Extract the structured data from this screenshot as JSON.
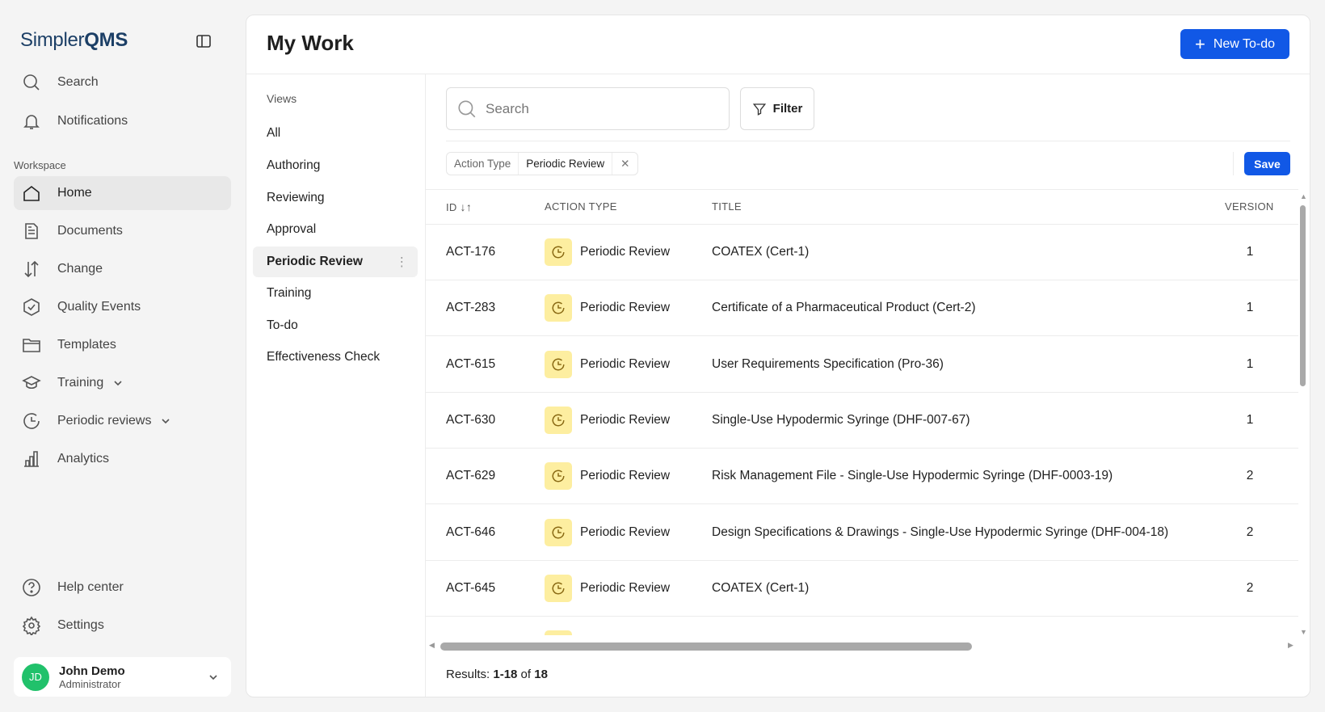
{
  "brand": {
    "name_part1": "Simpler",
    "name_part2": "QMS"
  },
  "sidebar": {
    "search": "Search",
    "notifications": "Notifications",
    "section": "Workspace",
    "items": [
      {
        "label": "Home"
      },
      {
        "label": "Documents"
      },
      {
        "label": "Change"
      },
      {
        "label": "Quality Events"
      },
      {
        "label": "Templates"
      },
      {
        "label": "Training"
      },
      {
        "label": "Periodic reviews"
      },
      {
        "label": "Analytics"
      }
    ],
    "help": "Help center",
    "settings": "Settings",
    "user": {
      "initials": "JD",
      "name": "John Demo",
      "role": "Administrator"
    }
  },
  "header": {
    "title": "My Work",
    "new_button": "New To-do"
  },
  "views": {
    "label": "Views",
    "items": [
      "All",
      "Authoring",
      "Reviewing",
      "Approval",
      "Periodic Review",
      "Training",
      "To-do",
      "Effectiveness Check"
    ],
    "active": "Periodic Review"
  },
  "toolbar": {
    "search_placeholder": "Search",
    "filter_label": "Filter",
    "save_label": "Save"
  },
  "active_filter": {
    "key": "Action Type",
    "value": "Periodic Review"
  },
  "table": {
    "columns": [
      "ID",
      "ACTION TYPE",
      "TITLE",
      "VERSION"
    ],
    "rows": [
      {
        "id": "ACT-176",
        "type": "Periodic Review",
        "title": "COATEX (Cert-1)",
        "version": "1"
      },
      {
        "id": "ACT-283",
        "type": "Periodic Review",
        "title": "Certificate of a Pharmaceutical Product (Cert-2)",
        "version": "1"
      },
      {
        "id": "ACT-615",
        "type": "Periodic Review",
        "title": "User Requirements Specification (Pro-36)",
        "version": "1"
      },
      {
        "id": "ACT-630",
        "type": "Periodic Review",
        "title": "Single-Use Hypodermic Syringe (DHF-007-67)",
        "version": "1"
      },
      {
        "id": "ACT-629",
        "type": "Periodic Review",
        "title": "Risk Management File - Single-Use Hypodermic Syringe (DHF-0003-19)",
        "version": "2"
      },
      {
        "id": "ACT-646",
        "type": "Periodic Review",
        "title": "Design Specifications & Drawings - Single-Use Hypodermic Syringe (DHF-004-18)",
        "version": "2"
      },
      {
        "id": "ACT-645",
        "type": "Periodic Review",
        "title": "COATEX (Cert-1)",
        "version": "2"
      }
    ]
  },
  "results": {
    "prefix": "Results: ",
    "range": "1-18",
    "of": " of ",
    "total": "18"
  }
}
